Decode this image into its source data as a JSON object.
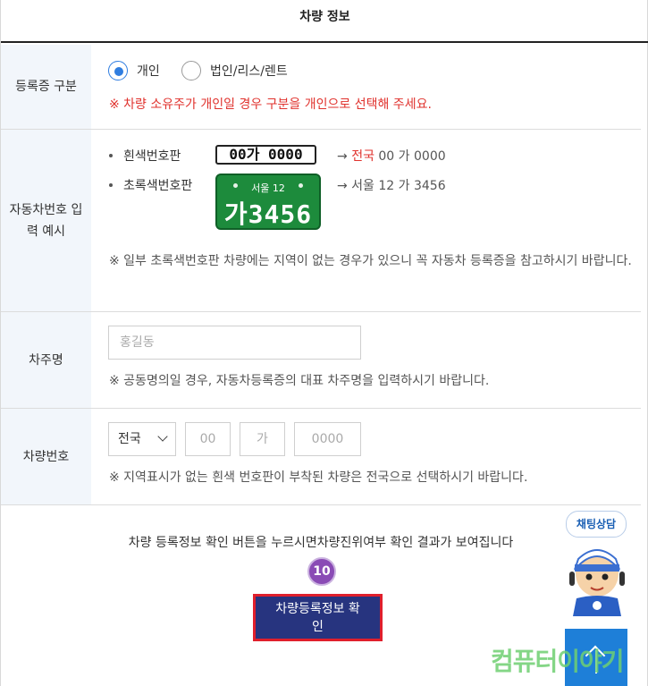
{
  "section": {
    "title": "차량 정보"
  },
  "registration": {
    "label": "등록증 구분",
    "options": [
      "개인",
      "법인/리스/렌트"
    ],
    "selected": "개인",
    "warning": "※ 차량 소유주가 개인일 경우 구분을 개인으로 선택해 주세요."
  },
  "plate_example": {
    "label": "자동차번호 입력 예시",
    "white_label": "흰색번호판",
    "white_plate_text": "00가 0000",
    "white_result_region": "전국",
    "white_result_rest": " 00 가 0000",
    "green_label": "초록색번호판",
    "green_plate_top": "서울 12",
    "green_plate_bottom": "가3456",
    "green_result": "→ 서울 12 가 3456",
    "arrow": "→",
    "note": "※ 일부 초록색번호판 차량에는 지역이 없는 경우가 있으니 꼭 자동차 등록증을 참고하시기 바랍니다."
  },
  "owner": {
    "label": "차주명",
    "placeholder": "홍길동",
    "note": "※ 공동명의일 경우, 자동차등록증의 대표 차주명을 입력하시기 바랍니다."
  },
  "vehicle_number": {
    "label": "차량번호",
    "region_select": "전국",
    "num_placeholder": "00",
    "char_placeholder": "가",
    "digits_placeholder": "0000",
    "note": "※ 지역표시가 없는 흰색 번호판이 부착된 차량은 전국으로 선택하시기 바랍니다."
  },
  "footer": {
    "info": "차량 등록정보 확인 버튼을 누르시면차량진위여부 확인 결과가 보여집니다",
    "step_number": "10",
    "confirm_button": "차량등록정보 확인",
    "consult_label": "채팅상담",
    "watermark": "컴퓨터이야기"
  },
  "colors": {
    "accent": "#2f7de0",
    "warning": "#e0322d",
    "button": "#27347f",
    "plate_green": "#1d8b3c"
  }
}
